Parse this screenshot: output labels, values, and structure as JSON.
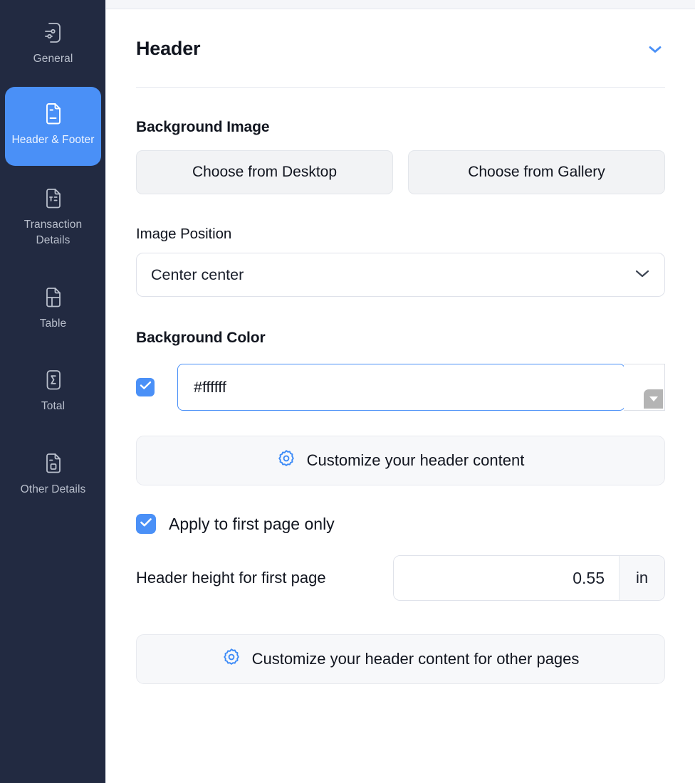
{
  "sidebar": {
    "items": [
      {
        "id": "general",
        "label": "General",
        "icon": "document-sliders-icon",
        "active": false
      },
      {
        "id": "header-footer",
        "label": "Header & Footer",
        "icon": "document-lines-icon",
        "active": true
      },
      {
        "id": "transaction",
        "label": "Transaction Details",
        "icon": "document-text-icon",
        "active": false
      },
      {
        "id": "table",
        "label": "Table",
        "icon": "document-grid-icon",
        "active": false
      },
      {
        "id": "total",
        "label": "Total",
        "icon": "document-sigma-icon",
        "active": false
      },
      {
        "id": "other",
        "label": "Other Details",
        "icon": "document-square-icon",
        "active": false
      }
    ]
  },
  "section": {
    "title": "Header",
    "collapse_icon": "chevron-down-icon"
  },
  "background_image": {
    "label": "Background Image",
    "choose_desktop_label": "Choose from Desktop",
    "choose_gallery_label": "Choose from Gallery"
  },
  "image_position": {
    "label": "Image Position",
    "value": "Center center",
    "dropdown_icon": "chevron-down-icon",
    "options": [
      "Center center"
    ]
  },
  "background_color": {
    "label": "Background Color",
    "enabled": true,
    "checkbox_icon": "check-icon",
    "value": "#ffffff",
    "swatch_color": "#ffffff",
    "swatch_caret_icon": "caret-down-icon"
  },
  "customize_header": {
    "label": "Customize your header content",
    "icon": "gear-icon"
  },
  "apply_first_page": {
    "label": "Apply to first page only",
    "checked": true,
    "checkbox_icon": "check-icon"
  },
  "header_height": {
    "label": "Header height for first page",
    "value": "0.55",
    "unit": "in"
  },
  "customize_header_other": {
    "label": "Customize your header content for other pages",
    "icon": "gear-icon"
  },
  "colors": {
    "sidebar_bg": "#222a41",
    "accent": "#4a90f7",
    "text": "#11151f",
    "muted_text": "#b9bfcc",
    "panel_bg": "#ffffff",
    "soft_bg": "#f7f8fa"
  }
}
